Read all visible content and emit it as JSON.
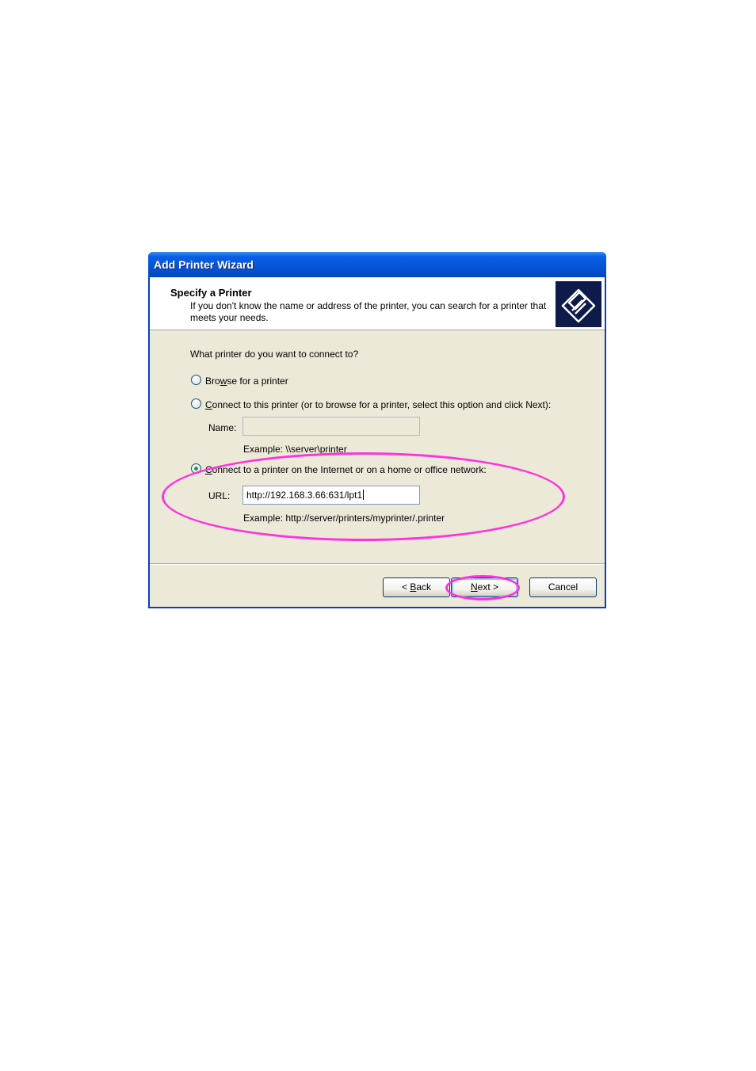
{
  "window": {
    "title": "Add Printer Wizard"
  },
  "header": {
    "title": "Specify a Printer",
    "description": "If you don't know the name or address of the printer, you can search for a printer that meets your needs.",
    "icon": "printer-wizard-icon"
  },
  "question": "What printer do you want to connect to?",
  "options": {
    "browse": {
      "pre": "Bro",
      "mnemonic": "w",
      "post": "se for a printer",
      "selected": false
    },
    "connect": {
      "pre": "",
      "mnemonic": "C",
      "post": "onnect to this printer (or to browse for a printer, select this option and click Next):",
      "selected": false
    },
    "internet": {
      "pre": "",
      "mnemonic": "C",
      "post": "onnect to a printer on the Internet or on a home or office network:",
      "selected": true
    }
  },
  "name_field": {
    "label": "Name:",
    "value": "",
    "example": "Example: \\\\server\\printer"
  },
  "url_field": {
    "label": "URL:",
    "value": "http://192.168.3.66:631/lpt1",
    "example": "Example: http://server/printers/myprinter/.printer"
  },
  "buttons": {
    "back": {
      "pre": "< ",
      "mnemonic": "B",
      "post": "ack"
    },
    "next": {
      "pre": "",
      "mnemonic": "N",
      "post": "ext >"
    },
    "cancel": "Cancel"
  },
  "annotation_color": "#ff33dd"
}
